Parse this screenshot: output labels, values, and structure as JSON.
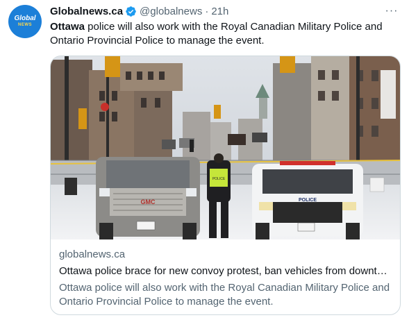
{
  "tweet": {
    "display_name": "Globalnews.ca",
    "handle": "@globalnews",
    "separator": "·",
    "time": "21h",
    "more_label": "···",
    "text_bold": "Ottawa",
    "text_rest": " police will also work with the Royal Canadian Military Police and Ontario Provincial Police to manage the event."
  },
  "avatar": {
    "logo_top": "Global",
    "logo_bottom": "NEWS"
  },
  "card": {
    "domain": "globalnews.ca",
    "title": "Ottawa police brace for new convoy protest, ban vehicles from downtown core",
    "description": "Ottawa police will also work with the Royal Canadian Military Police and Ontario Provincial Police to manage the event.",
    "image_texts": {
      "gmc_logo": "GMC",
      "police_vehicle": "POLICE",
      "vest_text": "POLICE"
    }
  },
  "colors": {
    "brand": "#1c7fd8",
    "verified": "#1d9bf0",
    "text": "#0f1419",
    "muted": "#536471",
    "border": "#cfd9de"
  },
  "icons": {
    "verified": "verified-badge-icon",
    "more": "more-options-icon"
  }
}
